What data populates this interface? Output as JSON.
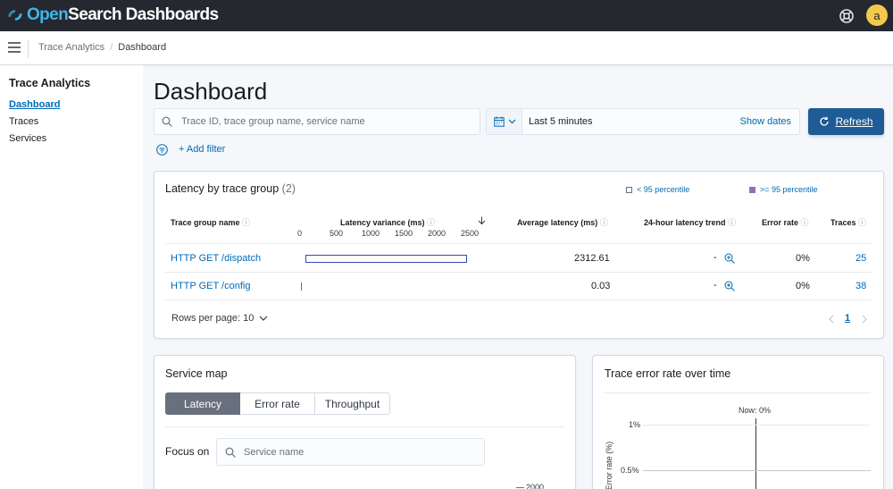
{
  "app": {
    "brand_a": "Open",
    "brand_b": "Search Dashboards",
    "avatar_initial": "a"
  },
  "breadcrumbs": [
    "Trace Analytics",
    "Dashboard"
  ],
  "sidebar": {
    "title": "Trace Analytics",
    "items": [
      {
        "label": "Dashboard",
        "active": true
      },
      {
        "label": "Traces",
        "active": false
      },
      {
        "label": "Services",
        "active": false
      }
    ]
  },
  "page": {
    "title": "Dashboard"
  },
  "search": {
    "placeholder": "Trace ID, trace group name, service name"
  },
  "date_picker": {
    "range": "Last 5 minutes",
    "show_dates": "Show dates"
  },
  "refresh": {
    "label": "Refresh"
  },
  "filters": {
    "add_filter": "+ Add filter"
  },
  "latency_panel": {
    "title": "Latency by trace group",
    "count": "(2)",
    "legend": {
      "below": "< 95 percentile",
      "above": ">= 95 percentile"
    },
    "columns": [
      "Trace group name",
      "Latency variance (ms)",
      "Average latency (ms)",
      "24-hour latency trend",
      "Error rate",
      "Traces"
    ],
    "axis_ticks": [
      "0",
      "500",
      "1000",
      "1500",
      "2000",
      "2500"
    ],
    "rows": [
      {
        "name": "HTTP GET /dispatch",
        "variance_min": 80,
        "variance_max": 2530,
        "avg_latency": "2312.61",
        "trend": "-",
        "error_rate": "0%",
        "traces": "25"
      },
      {
        "name": "HTTP GET /config",
        "variance_min": 10,
        "variance_max": 10,
        "avg_latency": "0.03",
        "trend": "-",
        "error_rate": "0%",
        "traces": "38"
      }
    ],
    "rows_per_page": "Rows per page: 10",
    "page": "1"
  },
  "service_map": {
    "title": "Service map",
    "tabs": [
      {
        "label": "Latency",
        "selected": true
      },
      {
        "label": "Error rate",
        "selected": false
      },
      {
        "label": "Throughput",
        "selected": false
      }
    ],
    "focus_label": "Focus on",
    "focus_placeholder": "Service name",
    "legend_value": "2000"
  },
  "error_panel": {
    "title": "Trace error rate over time",
    "now_label": "Now: 0%",
    "y_ticks": [
      "1%",
      "0.5%"
    ],
    "y_label": "Error rate (%)"
  },
  "colors": {
    "accent": "#006bb4",
    "refresh": "#1d5c96",
    "topbar": "#25282f",
    "percentile_high": "#9170b8"
  }
}
